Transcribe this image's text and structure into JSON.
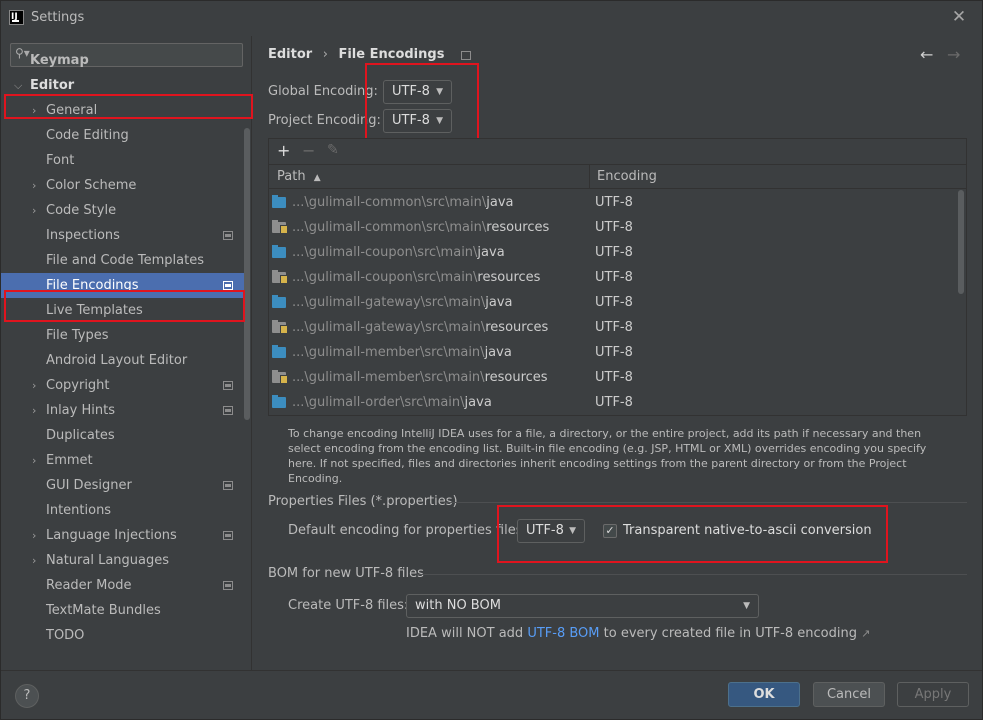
{
  "window": {
    "title": "Settings"
  },
  "sidebar": {
    "search_placeholder": "",
    "items": [
      {
        "label": "Keymap"
      },
      {
        "label": "Editor"
      },
      {
        "label": "General"
      },
      {
        "label": "Code Editing"
      },
      {
        "label": "Font"
      },
      {
        "label": "Color Scheme"
      },
      {
        "label": "Code Style"
      },
      {
        "label": "Inspections"
      },
      {
        "label": "File and Code Templates"
      },
      {
        "label": "File Encodings"
      },
      {
        "label": "Live Templates"
      },
      {
        "label": "File Types"
      },
      {
        "label": "Android Layout Editor"
      },
      {
        "label": "Copyright"
      },
      {
        "label": "Inlay Hints"
      },
      {
        "label": "Duplicates"
      },
      {
        "label": "Emmet"
      },
      {
        "label": "GUI Designer"
      },
      {
        "label": "Intentions"
      },
      {
        "label": "Language Injections"
      },
      {
        "label": "Natural Languages"
      },
      {
        "label": "Reader Mode"
      },
      {
        "label": "TextMate Bundles"
      },
      {
        "label": "TODO"
      }
    ]
  },
  "breadcrumb": {
    "parent": "Editor",
    "separator": "›",
    "current": "File Encodings"
  },
  "encodings": {
    "global_label": "Global Encoding:",
    "global_value": "UTF-8",
    "project_label": "Project Encoding:",
    "project_value": "UTF-8"
  },
  "table": {
    "columns": [
      "Path",
      "Encoding"
    ],
    "sort_indicator": "▲",
    "rows": [
      {
        "prefix": "...\\gulimall-common\\src\\main\\",
        "suffix": "java",
        "encoding": "UTF-8"
      },
      {
        "prefix": "...\\gulimall-common\\src\\main\\",
        "suffix": "resources",
        "encoding": "UTF-8"
      },
      {
        "prefix": "...\\gulimall-coupon\\src\\main\\",
        "suffix": "java",
        "encoding": "UTF-8"
      },
      {
        "prefix": "...\\gulimall-coupon\\src\\main\\",
        "suffix": "resources",
        "encoding": "UTF-8"
      },
      {
        "prefix": "...\\gulimall-gateway\\src\\main\\",
        "suffix": "java",
        "encoding": "UTF-8"
      },
      {
        "prefix": "...\\gulimall-gateway\\src\\main\\",
        "suffix": "resources",
        "encoding": "UTF-8"
      },
      {
        "prefix": "...\\gulimall-member\\src\\main\\",
        "suffix": "java",
        "encoding": "UTF-8"
      },
      {
        "prefix": "...\\gulimall-member\\src\\main\\",
        "suffix": "resources",
        "encoding": "UTF-8"
      },
      {
        "prefix": "...\\gulimall-order\\src\\main\\",
        "suffix": "java",
        "encoding": "UTF-8"
      }
    ]
  },
  "help_text": "To change encoding IntelliJ IDEA uses for a file, a directory, or the entire project, add its path if necessary and then select encoding from the encoding list. Built-in file encoding (e.g. JSP, HTML or XML) overrides encoding you specify here. If not specified, files and directories inherit encoding settings from the parent directory or from the Project Encoding.",
  "properties": {
    "section_title": "Properties Files (*.properties)",
    "default_label": "Default encoding for properties files:",
    "default_value": "UTF-8",
    "checkbox_label": "Transparent native-to-ascii conversion",
    "checkbox_checked": true
  },
  "bom": {
    "section_title": "BOM for new UTF-8 files",
    "create_label": "Create UTF-8 files:",
    "create_value": "with NO BOM",
    "info_prefix": "IDEA will NOT add ",
    "info_link": "UTF-8 BOM",
    "info_suffix": " to every created file in UTF-8 encoding"
  },
  "footer": {
    "help": "?",
    "ok": "OK",
    "cancel": "Cancel",
    "apply": "Apply"
  },
  "colors": {
    "highlight": "#e0141e",
    "selection": "#4b6eaf",
    "link": "#589df6"
  }
}
